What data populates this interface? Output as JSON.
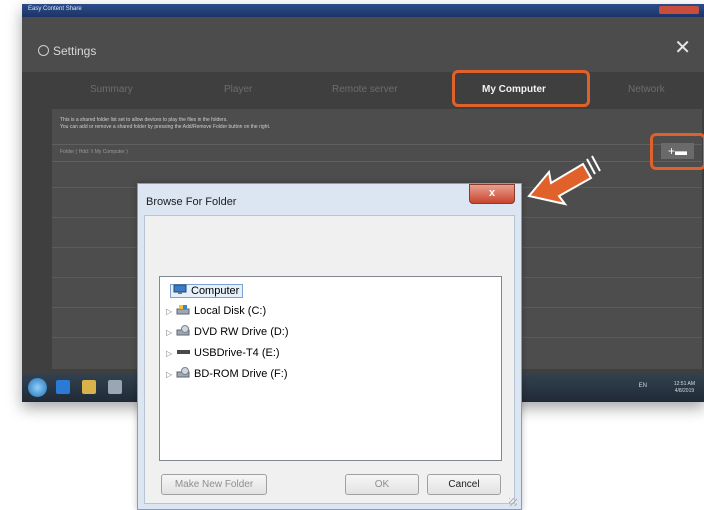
{
  "app": {
    "window_title": "Easy Content Share",
    "settings_title": "Settings",
    "tabs": [
      {
        "label": "Summary",
        "active": false
      },
      {
        "label": "Player",
        "active": false
      },
      {
        "label": "Remote server",
        "active": false
      },
      {
        "label": "My Computer",
        "active": true
      },
      {
        "label": "Network",
        "active": false
      }
    ],
    "info_line1": "This is a shared folder list set to allow devices to play the files in the folders.",
    "info_line2": "You can add or remove a shared folder by pressing the Add/Remove Folder button on the right.",
    "folder_path": "Folder  ( Hdd: \\\\  My Computer )",
    "add_button_icon": "+▬",
    "accent_color": "#e0612a"
  },
  "taskbar": {
    "tray_text": "EN",
    "clock_time": "12:51 AM",
    "clock_date": "4/8/2019"
  },
  "dialog": {
    "title": "Browse For Folder",
    "close_label": "x",
    "tree": [
      {
        "label": "Computer",
        "icon": "computer-icon",
        "selected": true
      },
      {
        "label": "Local Disk (C:)",
        "icon": "local-disk-icon"
      },
      {
        "label": "DVD RW Drive (D:)",
        "icon": "dvd-drive-icon"
      },
      {
        "label": "USBDrive-T4 (E:)",
        "icon": "usb-drive-icon"
      },
      {
        "label": "BD-ROM Drive (F:)",
        "icon": "bd-drive-icon"
      }
    ],
    "buttons": {
      "new_folder": "Make New Folder",
      "ok": "OK",
      "cancel": "Cancel"
    }
  }
}
